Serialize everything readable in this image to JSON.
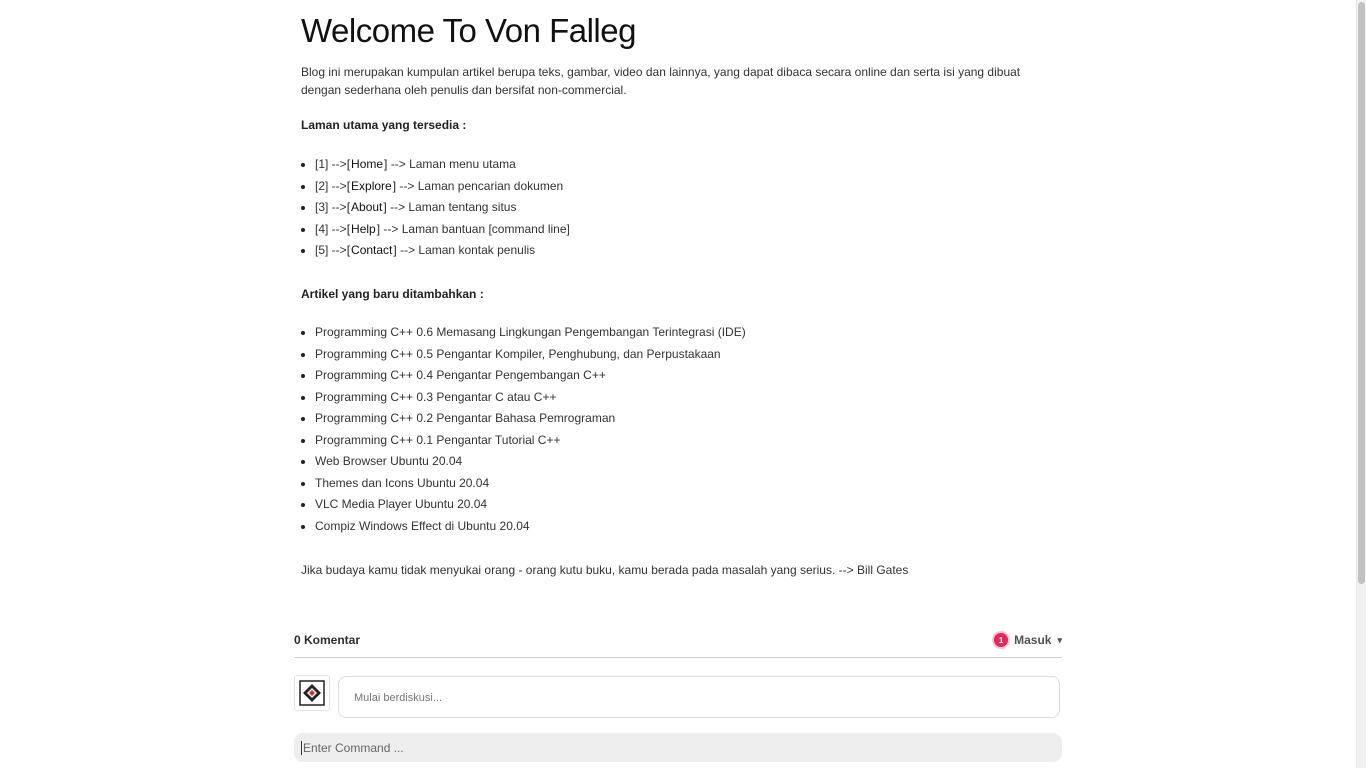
{
  "page": {
    "title": "Welcome To Von Falleg",
    "intro": "Blog ini merupakan kumpulan artikel berupa teks, gambar, video dan lainnya, yang dapat dibaca secara online dan serta isi yang dibuat dengan sederhana oleh penulis dan bersifat non-commercial.",
    "pages_heading": "Laman utama yang tersedia :",
    "pages": [
      {
        "index": "[1] -->",
        "label": "Home",
        "desc": "--> Laman menu utama"
      },
      {
        "index": "[2] -->",
        "label": "Explore",
        "desc": "--> Laman pencarian dokumen"
      },
      {
        "index": "[3] -->",
        "label": "About",
        "desc": "--> Laman tentang situs"
      },
      {
        "index": "[4] -->",
        "label": "Help",
        "desc": "--> Laman bantuan [command line]"
      },
      {
        "index": "[5] -->",
        "label": "Contact",
        "desc": "--> Laman kontak penulis"
      }
    ],
    "articles_heading": "Artikel yang baru ditambahkan :",
    "articles": [
      "Programming C++ 0.6 Memasang Lingkungan Pengembangan Terintegrasi (IDE)",
      "Programming C++ 0.5 Pengantar Kompiler, Penghubung, dan Perpustakaan",
      "Programming C++ 0.4 Pengantar Pengembangan C++",
      "Programming C++ 0.3 Pengantar C atau C++",
      "Programming C++ 0.2 Pengantar Bahasa Pemrograman",
      "Programming C++ 0.1 Pengantar Tutorial C++",
      "Web Browser Ubuntu 20.04",
      "Themes dan Icons Ubuntu 20.04",
      "VLC Media Player Ubuntu 20.04",
      "Compiz Windows Effect di Ubuntu 20.04"
    ],
    "quote": "Jika budaya kamu tidak menyukai orang - orang kutu buku, kamu berada pada masalah yang serius. --> Bill Gates"
  },
  "comments": {
    "count_label": "0 Komentar",
    "notification_count": "1",
    "login_label": "Masuk",
    "caret": "▾",
    "discuss_placeholder": "Mulai berdiskusi..."
  },
  "command": {
    "placeholder": "Enter Command ..."
  },
  "colors": {
    "badge": "#e8245a",
    "command_bg": "#eeeeee",
    "text": "#333333"
  }
}
